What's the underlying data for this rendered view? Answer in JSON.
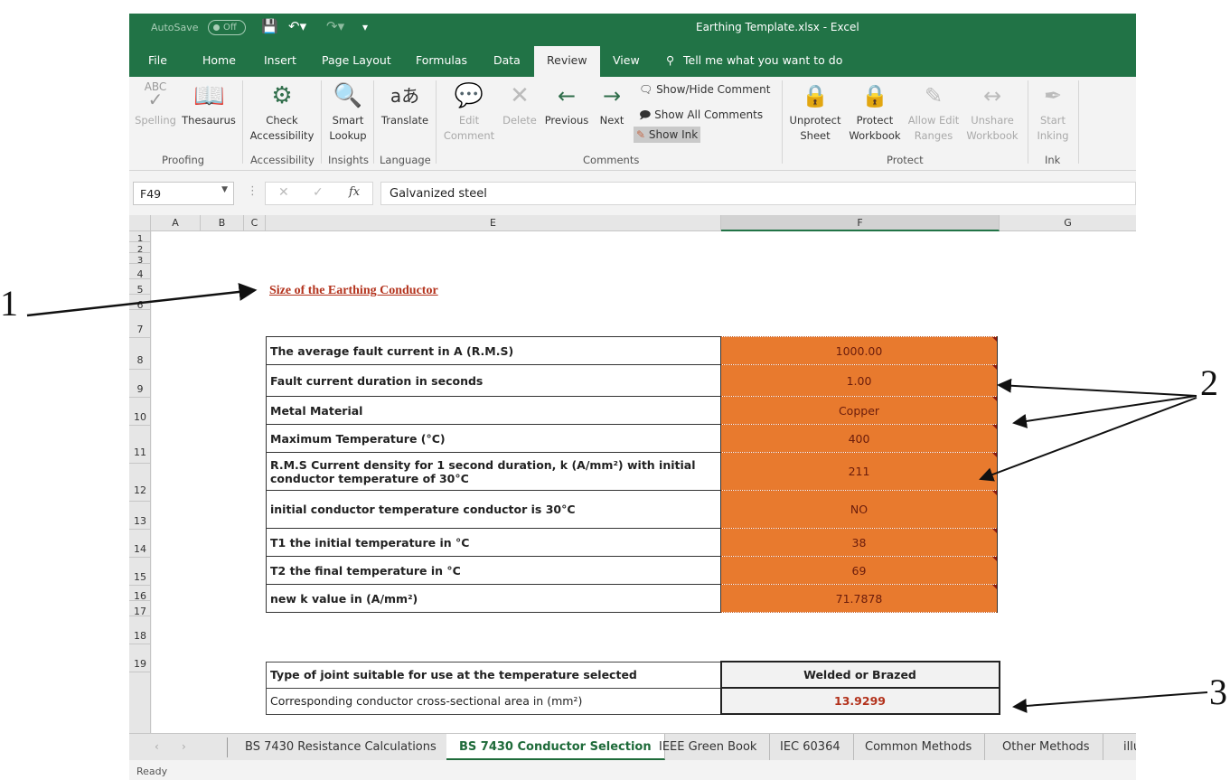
{
  "window": {
    "title": "Earthing Template.xlsx  -  Excel",
    "autosave_label": "AutoSave",
    "autosave_state": "Off"
  },
  "tabs": [
    {
      "label": "File"
    },
    {
      "label": "Home"
    },
    {
      "label": "Insert"
    },
    {
      "label": "Page Layout"
    },
    {
      "label": "Formulas"
    },
    {
      "label": "Data"
    },
    {
      "label": "Review",
      "active": true
    },
    {
      "label": "View"
    }
  ],
  "tell_me": "Tell me what you want to do",
  "ribbon": {
    "groups": {
      "proofing": "Proofing",
      "accessibility": "Accessibility",
      "insights": "Insights",
      "language": "Language",
      "comments": "Comments",
      "protect": "Protect",
      "ink": "Ink"
    },
    "spelling": "Spelling",
    "thesaurus": "Thesaurus",
    "check_accessibility": [
      "Check",
      "Accessibility"
    ],
    "smart_lookup": [
      "Smart",
      "Lookup"
    ],
    "translate": "Translate",
    "edit_comment": [
      "Edit",
      "Comment"
    ],
    "delete": "Delete",
    "previous": "Previous",
    "next": "Next",
    "show_hide_comment": "Show/Hide Comment",
    "show_all_comments": "Show All Comments",
    "show_ink": "Show Ink",
    "unprotect_sheet": [
      "Unprotect",
      "Sheet"
    ],
    "protect_workbook": [
      "Protect",
      "Workbook"
    ],
    "allow_edit_ranges": [
      "Allow Edit",
      "Ranges"
    ],
    "unshare_workbook": [
      "Unshare",
      "Workbook"
    ],
    "start_inking": [
      "Start",
      "Inking"
    ]
  },
  "formula_bar": {
    "name_box": "F49",
    "fx": "fx",
    "value": "Galvanized steel"
  },
  "columns": [
    "A",
    "B",
    "C",
    "E",
    "F",
    "G"
  ],
  "rows": [
    "1",
    "2",
    "3",
    "4",
    "5",
    "6",
    "7",
    "8",
    "9",
    "10",
    "11",
    "12",
    "13",
    "14",
    "15",
    "16",
    "17",
    "18",
    "19"
  ],
  "sheet": {
    "heading": "Size of the Earthing Conductor",
    "inputs": [
      {
        "label": "The average fault current in A (R.M.S)",
        "value": "1000.00"
      },
      {
        "label": "Fault current duration in seconds",
        "value": "1.00"
      },
      {
        "label": "Metal Material",
        "value": "Copper"
      },
      {
        "label": "Maximum Temperature (°C)",
        "value": "400"
      },
      {
        "label": "R.M.S Current density for 1 second duration, k (A/mm²) with initial conductor temperature of 30°C",
        "value": "211"
      },
      {
        "label": "initial conductor temperature conductor is 30°C",
        "value": "NO"
      },
      {
        "label": "T1   the initial temperature in °C",
        "value": "38"
      },
      {
        "label": "T2   the final temperature in °C",
        "value": "69"
      },
      {
        "label": "new   k   value in (A/mm²)",
        "value": "71.7878"
      }
    ],
    "results": [
      {
        "label": "Type of joint suitable for use at the temperature selected",
        "value": "Welded or Brazed"
      },
      {
        "label": "Corresponding conductor cross-sectional area in (mm²)",
        "value": "13.9299"
      }
    ]
  },
  "sheet_tabs": [
    {
      "label": "BS 7430 Resistance Calculations"
    },
    {
      "label": "BS 7430 Conductor Selection",
      "active": true
    },
    {
      "label": "IEEE Green Book"
    },
    {
      "label": "IEC 60364"
    },
    {
      "label": "Common Methods"
    },
    {
      "label": "Other Methods"
    },
    {
      "label": "illu"
    }
  ],
  "status": "Ready",
  "annotations": [
    "1",
    "2",
    "3"
  ],
  "colors": {
    "excel_green": "#217346",
    "input_fill": "#e87a2e",
    "result_text": "#b3321c"
  }
}
